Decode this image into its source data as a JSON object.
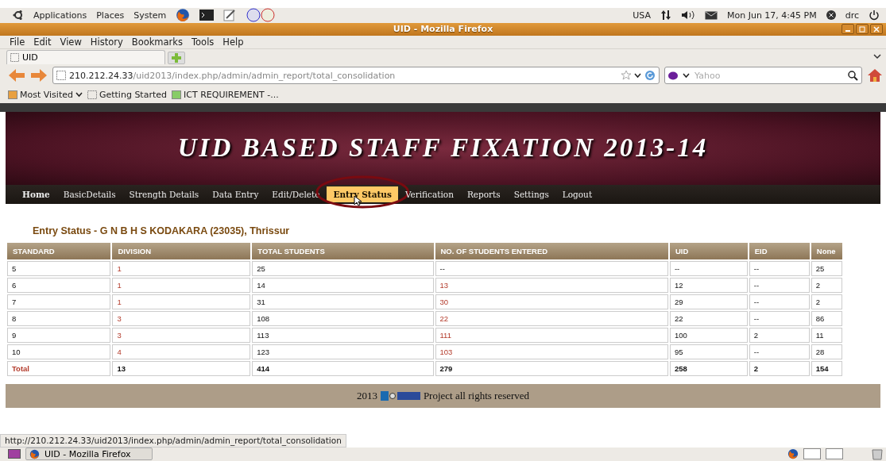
{
  "top_panel": {
    "menus": [
      "Applications",
      "Places",
      "System"
    ],
    "keyboard": "USA",
    "clock": "Mon Jun 17,  4:45 PM",
    "user": "drc"
  },
  "window": {
    "title": "UID - Mozilla Firefox"
  },
  "menu_bar": [
    "File",
    "Edit",
    "View",
    "History",
    "Bookmarks",
    "Tools",
    "Help"
  ],
  "tabs": [
    {
      "label": "UID",
      "selected": true
    }
  ],
  "address_bar": {
    "host": "210.212.24.33",
    "path": "/uid2013/index.php/admin/admin_report/total_consolidation"
  },
  "search": {
    "placeholder": "Yahoo"
  },
  "bookmarks": [
    "Most Visited",
    "Getting Started",
    "ICT REQUIREMENT -..."
  ],
  "banner": {
    "title": "UID BASED STAFF FIXATION 2013-14"
  },
  "nav": [
    {
      "label": "Home",
      "selected": false,
      "bold": true
    },
    {
      "label": "BasicDetails",
      "selected": false,
      "bold": false
    },
    {
      "label": "Strength Details",
      "selected": false,
      "bold": false
    },
    {
      "label": "Data Entry",
      "selected": false,
      "bold": false
    },
    {
      "label": "Edit/Delete",
      "selected": false,
      "bold": false
    },
    {
      "label": "Entry Status",
      "selected": true,
      "bold": true
    },
    {
      "label": "Verification",
      "selected": false,
      "bold": false
    },
    {
      "label": "Reports",
      "selected": false,
      "bold": false
    },
    {
      "label": "Settings",
      "selected": false,
      "bold": false
    },
    {
      "label": "Logout",
      "selected": false,
      "bold": false
    }
  ],
  "heading": "Entry Status - G N B H S KODAKARA (23035), Thrissur",
  "table": {
    "columns": [
      "STANDARD",
      "DIVISION",
      "TOTAL STUDENTS",
      "NO. OF STUDENTS ENTERED",
      "UID",
      "EID",
      "None"
    ],
    "rows": [
      {
        "cells": [
          {
            "text": "5",
            "link": false
          },
          {
            "text": "1",
            "link": true
          },
          {
            "text": "25",
            "link": false
          },
          {
            "text": "--",
            "link": false
          },
          {
            "text": "--",
            "link": false
          },
          {
            "text": "--",
            "link": false
          },
          {
            "text": "25",
            "link": false
          }
        ]
      },
      {
        "cells": [
          {
            "text": "6",
            "link": false
          },
          {
            "text": "1",
            "link": true
          },
          {
            "text": "14",
            "link": false
          },
          {
            "text": "13",
            "link": true
          },
          {
            "text": "12",
            "link": false
          },
          {
            "text": "--",
            "link": false
          },
          {
            "text": "2",
            "link": false
          }
        ]
      },
      {
        "cells": [
          {
            "text": "7",
            "link": false
          },
          {
            "text": "1",
            "link": true
          },
          {
            "text": "31",
            "link": false
          },
          {
            "text": "30",
            "link": true
          },
          {
            "text": "29",
            "link": false
          },
          {
            "text": "--",
            "link": false
          },
          {
            "text": "2",
            "link": false
          }
        ]
      },
      {
        "cells": [
          {
            "text": "8",
            "link": false
          },
          {
            "text": "3",
            "link": true
          },
          {
            "text": "108",
            "link": false
          },
          {
            "text": "22",
            "link": true
          },
          {
            "text": "22",
            "link": false
          },
          {
            "text": "--",
            "link": false
          },
          {
            "text": "86",
            "link": false
          }
        ]
      },
      {
        "cells": [
          {
            "text": "9",
            "link": false
          },
          {
            "text": "3",
            "link": true
          },
          {
            "text": "113",
            "link": false
          },
          {
            "text": "111",
            "link": true
          },
          {
            "text": "100",
            "link": false
          },
          {
            "text": "2",
            "link": false
          },
          {
            "text": "11",
            "link": false
          }
        ]
      },
      {
        "cells": [
          {
            "text": "10",
            "link": false
          },
          {
            "text": "4",
            "link": true
          },
          {
            "text": "123",
            "link": false
          },
          {
            "text": "103",
            "link": true
          },
          {
            "text": "95",
            "link": false
          },
          {
            "text": "--",
            "link": false
          },
          {
            "text": "28",
            "link": false
          }
        ]
      }
    ],
    "total": [
      "Total",
      "13",
      "414",
      "279",
      "258",
      "2",
      "154"
    ]
  },
  "footer": {
    "year": "2013",
    "text": "Project all rights reserved"
  },
  "status_bar": "http://210.212.24.33/uid2013/index.php/admin/admin_report/total_consolidation",
  "taskbar": {
    "window": "UID - Mozilla Firefox"
  }
}
